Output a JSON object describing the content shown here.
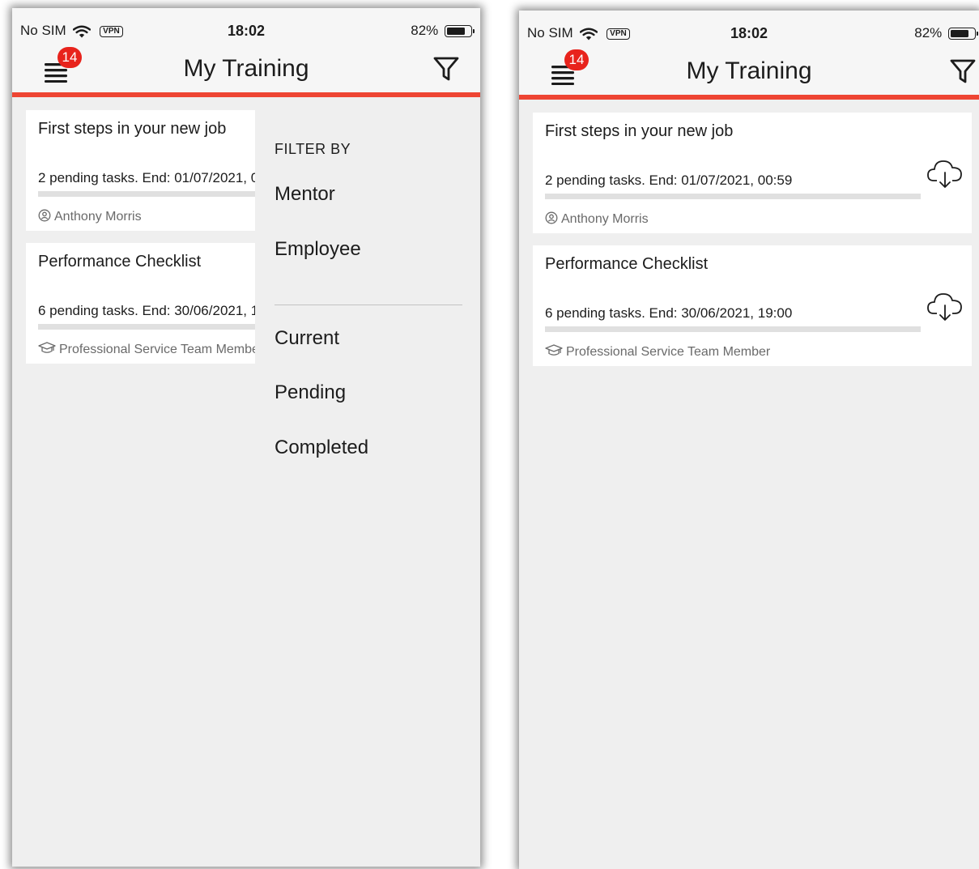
{
  "status_bar": {
    "carrier": "No SIM",
    "vpn": "VPN",
    "time": "18:02",
    "battery": "82%",
    "battery_level": 0.82
  },
  "header": {
    "title": "My Training",
    "notification_count": "14"
  },
  "trainings": [
    {
      "title": "First steps in your new job",
      "tasks": "2 pending tasks. End: 01/07/2021, 00:59",
      "owner": "Anthony Morris",
      "owner_icon": "person-badge-icon",
      "progress": 0
    },
    {
      "title": "Performance Checklist",
      "tasks": "6 pending tasks. End: 30/06/2021, 19:00",
      "owner": "Professional Service Team Member",
      "owner_icon": "graduation-cap-icon",
      "progress": 0
    }
  ],
  "filter_panel": {
    "heading": "FILTER BY",
    "role_options": [
      "Mentor",
      "Employee"
    ],
    "status_options": [
      "Current",
      "Pending",
      "Completed"
    ]
  },
  "colors": {
    "accent": "#ee4533",
    "badge": "#e8231c",
    "background": "#efefef",
    "card": "#ffffff"
  }
}
